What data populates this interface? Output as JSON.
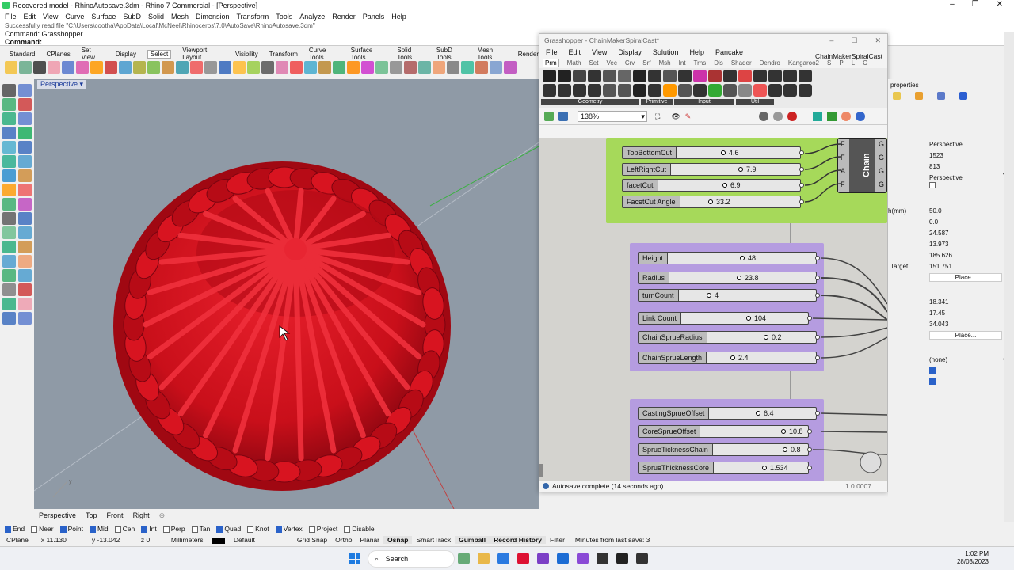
{
  "window": {
    "title": "Recovered model - RhinoAutosave.3dm - Rhino 7 Commercial - [Perspective]"
  },
  "menu": [
    "File",
    "Edit",
    "View",
    "Curve",
    "Surface",
    "SubD",
    "Solid",
    "Mesh",
    "Dimension",
    "Transform",
    "Tools",
    "Analyze",
    "Render",
    "Panels",
    "Help"
  ],
  "command": {
    "line1": "Successfully read file \"C:\\Users\\cootha\\AppData\\Local\\McNeel\\Rhinoceros\\7.0\\AutoSave\\RhinoAutosave.3dm\"",
    "line2": "Command: Grasshopper",
    "prompt": "Command:"
  },
  "toolbar_tabs": [
    "Standard",
    "CPlanes",
    "Set View",
    "Display",
    "Select",
    "Viewport Layout",
    "Visibility",
    "Transform",
    "Curve Tools",
    "Surface Tools",
    "Solid Tools",
    "SubD Tools",
    "Mesh Tools",
    "Render"
  ],
  "viewport": {
    "label": "Perspective"
  },
  "view_tabs": [
    "Perspective",
    "Top",
    "Front",
    "Right"
  ],
  "snaps": [
    {
      "label": "End",
      "on": true
    },
    {
      "label": "Near",
      "on": false
    },
    {
      "label": "Point",
      "on": true
    },
    {
      "label": "Mid",
      "on": true
    },
    {
      "label": "Cen",
      "on": false
    },
    {
      "label": "Int",
      "on": true
    },
    {
      "label": "Perp",
      "on": false
    },
    {
      "label": "Tan",
      "on": false
    },
    {
      "label": "Quad",
      "on": true
    },
    {
      "label": "Knot",
      "on": false
    },
    {
      "label": "Vertex",
      "on": true
    },
    {
      "label": "Project",
      "on": false
    },
    {
      "label": "Disable",
      "on": false
    }
  ],
  "status": {
    "cplane": "CPlane",
    "x": "x 11.130",
    "y": "y -13.042",
    "z": "z 0",
    "units": "Millimeters",
    "layer": "Default",
    "toggles": [
      "Grid Snap",
      "Ortho",
      "Planar",
      "Osnap",
      "SmartTrack",
      "Gumball",
      "Record History",
      "Filter"
    ],
    "filter_msg": "Minutes from last save: 3"
  },
  "grasshopper": {
    "title": "Grasshopper - ChainMakerSpiralCast*",
    "menu": [
      "File",
      "Edit",
      "View",
      "Display",
      "Solution",
      "Help",
      "Pancake"
    ],
    "doc_name": "ChainMakerSpiralCast",
    "tabs": [
      "Prm",
      "Math",
      "Set",
      "Vec",
      "Crv",
      "Srf",
      "Msh",
      "Int",
      "Trns",
      "Dis",
      "Shader",
      "Dendro",
      "Kangaroo2",
      "S",
      "P",
      "L",
      "C"
    ],
    "sections": [
      "Geometry",
      "Primitive",
      "Input",
      "Util"
    ],
    "zoom": "138%",
    "sliders_top": [
      {
        "label": "TopBottomCut",
        "value": "4.6"
      },
      {
        "label": "LeftRightCut",
        "value": "7.9"
      },
      {
        "label": "facetCut",
        "value": "6.9"
      },
      {
        "label": "FacetCut Angle",
        "value": "33.2"
      }
    ],
    "chain_component": {
      "name": "Chain",
      "inputs": [
        "F",
        "F",
        "A",
        "F"
      ],
      "outputs": [
        "G",
        "G",
        "G",
        "G"
      ]
    },
    "sliders_mid": [
      {
        "label": "Height",
        "value": "48"
      },
      {
        "label": "Radius",
        "value": "23.8"
      },
      {
        "label": "turnCount",
        "value": "4"
      },
      {
        "label": "Link Count",
        "value": "104"
      },
      {
        "label": "ChainSprueRadius",
        "value": "0.2"
      },
      {
        "label": "ChainSprueLength",
        "value": "2.4"
      }
    ],
    "sliders_bottom": [
      {
        "label": "CastingSprueOffset",
        "value": "6.4"
      },
      {
        "label": "CoreSprueOffset",
        "value": "10.8"
      },
      {
        "label": "SprueTicknessChain",
        "value": "0.8"
      },
      {
        "label": "SprueThicknessCore",
        "value": "1.534"
      }
    ],
    "status": "Autosave complete (14 seconds ago)",
    "version": "1.0.0007"
  },
  "properties": {
    "header": "properties",
    "values": [
      "Perspective",
      "1523",
      "813",
      "Perspective"
    ],
    "lens_label": "h(mm)",
    "lens_values": [
      "50.0",
      "0.0",
      "24.587",
      "13.973",
      "185.626"
    ],
    "target_label": "Target",
    "target_value": "151.751",
    "place_label": "Place...",
    "target_values": [
      "18.341",
      "17.45",
      "34.043"
    ],
    "place2_label": "Place...",
    "wallpaper": "(none)"
  },
  "taskbar": {
    "search": "Search",
    "time": "1:02 PM",
    "date": "28/03/2023"
  },
  "colors": {
    "chain_red": "#d4101c",
    "viewport_bg": "#8f9aa6",
    "gh_green": "#a6d95a",
    "gh_purple": "#b59ce0"
  }
}
